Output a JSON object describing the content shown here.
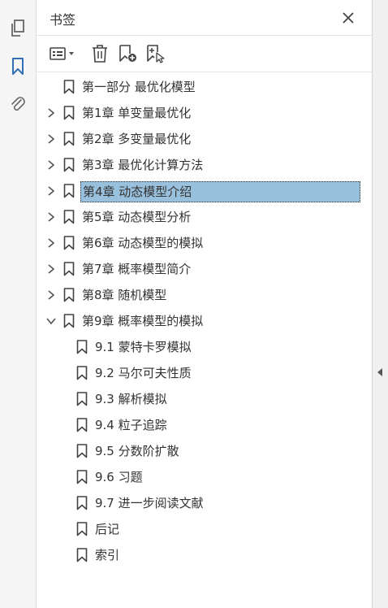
{
  "panel": {
    "title": "书签"
  },
  "rail": {
    "icons": [
      "pages-icon",
      "bookmarks-icon",
      "attachments-icon"
    ]
  },
  "toolbar": {
    "buttons": [
      "options-menu-icon",
      "delete-bookmark-icon",
      "new-bookmark-icon",
      "bookmark-from-selection-icon"
    ]
  },
  "bookmarks": [
    {
      "label": "第一部分  最优化模型",
      "level": 0,
      "expander": "none"
    },
    {
      "label": "第1章  单变量最优化",
      "level": 0,
      "expander": "collapsed"
    },
    {
      "label": "第2章  多变量最优化",
      "level": 0,
      "expander": "collapsed"
    },
    {
      "label": "第3章  最优化计算方法",
      "level": 0,
      "expander": "collapsed"
    },
    {
      "label": "第4章  动态模型介绍",
      "level": 0,
      "expander": "collapsed",
      "selected": true
    },
    {
      "label": "第5章  动态模型分析",
      "level": 0,
      "expander": "collapsed"
    },
    {
      "label": "第6章  动态模型的模拟",
      "level": 0,
      "expander": "collapsed"
    },
    {
      "label": "第7章  概率模型简介",
      "level": 0,
      "expander": "collapsed"
    },
    {
      "label": "第8章  随机模型",
      "level": 0,
      "expander": "collapsed"
    },
    {
      "label": "第9章  概率模型的模拟",
      "level": 0,
      "expander": "expanded"
    },
    {
      "label": "9.1  蒙特卡罗模拟",
      "level": 1,
      "expander": "none"
    },
    {
      "label": "9.2  马尔可夫性质",
      "level": 1,
      "expander": "none"
    },
    {
      "label": "9.3  解析模拟",
      "level": 1,
      "expander": "none"
    },
    {
      "label": "9.4  粒子追踪",
      "level": 1,
      "expander": "none"
    },
    {
      "label": "9.5  分数阶扩散",
      "level": 1,
      "expander": "none"
    },
    {
      "label": "9.6  习题",
      "level": 1,
      "expander": "none"
    },
    {
      "label": "9.7  进一步阅读文献",
      "level": 1,
      "expander": "none"
    },
    {
      "label": "后记",
      "level": 1,
      "expander": "none"
    },
    {
      "label": "索引",
      "level": 1,
      "expander": "none"
    }
  ],
  "colors": {
    "accent": "#2f6fb5",
    "selection": "#99c1de"
  }
}
